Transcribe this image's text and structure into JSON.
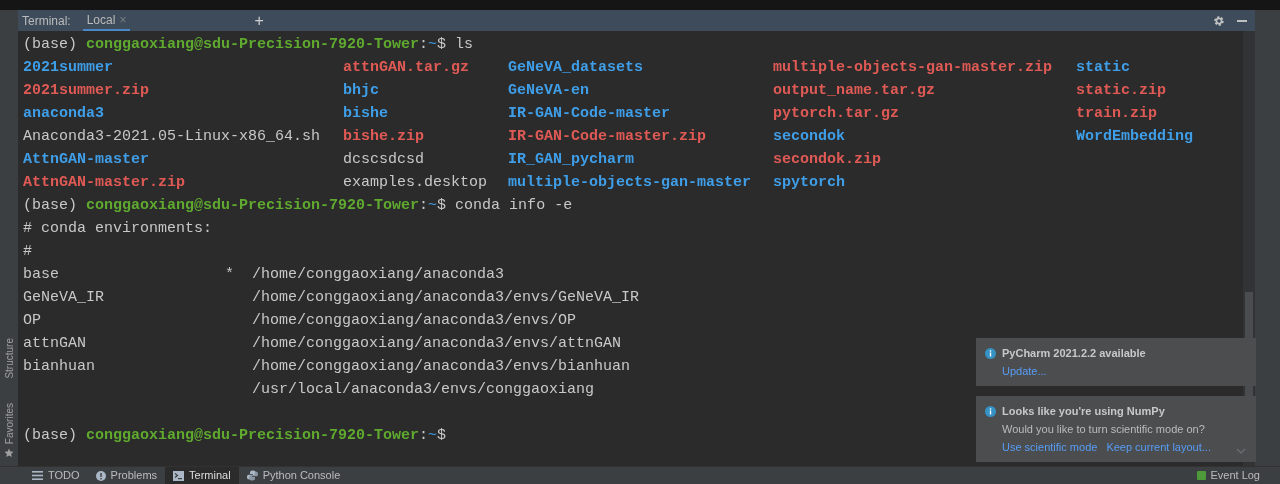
{
  "tool_window": {
    "title": "Terminal:",
    "tabs": [
      {
        "label": "Local",
        "close": "×",
        "selected": true
      }
    ],
    "add": "+"
  },
  "side_labels": [
    "Structure",
    "Favorites"
  ],
  "terminal": {
    "ls_prompt": {
      "env": "(base)",
      "user_host": "conggaoxiang@sdu-Precision-7920-Tower",
      "path": ":~$",
      "command": "ls"
    },
    "ls_columns": [
      [
        {
          "text": "2021summer",
          "kind": "dir"
        },
        {
          "text": "2021summer.zip",
          "kind": "archive"
        },
        {
          "text": "anaconda3",
          "kind": "dir"
        },
        {
          "text": "Anaconda3-2021.05-Linux-x86_64.sh",
          "kind": "file"
        },
        {
          "text": "AttnGAN-master",
          "kind": "dir"
        },
        {
          "text": "AttnGAN-master.zip",
          "kind": "archive"
        }
      ],
      [
        {
          "text": "attnGAN.tar.gz",
          "kind": "archive"
        },
        {
          "text": "bhjc",
          "kind": "dir"
        },
        {
          "text": "bishe",
          "kind": "dir"
        },
        {
          "text": "bishe.zip",
          "kind": "archive"
        },
        {
          "text": "dcscsdcsd",
          "kind": "file"
        },
        {
          "text": "examples.desktop",
          "kind": "file"
        }
      ],
      [
        {
          "text": "GeNeVA_datasets",
          "kind": "dir"
        },
        {
          "text": "GeNeVA-en",
          "kind": "dir"
        },
        {
          "text": "IR-GAN-Code-master",
          "kind": "dir"
        },
        {
          "text": "IR-GAN-Code-master.zip",
          "kind": "archive"
        },
        {
          "text": "IR_GAN_pycharm",
          "kind": "dir"
        },
        {
          "text": "multiple-objects-gan-master",
          "kind": "dir"
        }
      ],
      [
        {
          "text": "multiple-objects-gan-master.zip",
          "kind": "archive"
        },
        {
          "text": "output_name.tar.gz",
          "kind": "archive"
        },
        {
          "text": "pytorch.tar.gz",
          "kind": "archive"
        },
        {
          "text": "secondok",
          "kind": "dir"
        },
        {
          "text": "secondok.zip",
          "kind": "archive"
        },
        {
          "text": "spytorch",
          "kind": "dir"
        }
      ],
      [
        {
          "text": "static",
          "kind": "dir"
        },
        {
          "text": "static.zip",
          "kind": "archive"
        },
        {
          "text": "train.zip",
          "kind": "archive"
        },
        {
          "text": "WordEmbedding",
          "kind": "dir"
        }
      ]
    ],
    "conda_prompt": {
      "env": "(base)",
      "user_host": "conggaoxiang@sdu-Precision-7920-Tower",
      "path": ":~$",
      "command": "conda info -e"
    },
    "output_lines": [
      "# conda environments:",
      "#"
    ],
    "environments": [
      {
        "name": "base",
        "active": "*",
        "path": "/home/conggaoxiang/anaconda3"
      },
      {
        "name": "GeNeVA_IR",
        "path": "/home/conggaoxiang/anaconda3/envs/GeNeVA_IR"
      },
      {
        "name": "OP",
        "path": "/home/conggaoxiang/anaconda3/envs/OP"
      },
      {
        "name": "attnGAN",
        "path": "/home/conggaoxiang/anaconda3/envs/attnGAN"
      },
      {
        "name": "bianhuan",
        "path": "/home/conggaoxiang/anaconda3/envs/bianhuan"
      },
      {
        "path": "/usr/local/anaconda3/envs/conggaoxiang"
      }
    ],
    "last_prompt": {
      "env": "(base)",
      "user_host": "conggaoxiang@sdu-Precision-7920-Tower",
      "path": ":~$"
    }
  },
  "notifications": [
    {
      "title": "PyCharm 2021.2.2 available",
      "links": [
        "Update..."
      ]
    },
    {
      "title": "Looks like you're using NumPy",
      "body": "Would you like to turn scientific mode on?",
      "links": [
        "Use scientific mode",
        "Keep current layout..."
      ]
    }
  ],
  "bottom_tabs": [
    {
      "label": "TODO",
      "kind": "list",
      "selected": false
    },
    {
      "label": "Problems",
      "kind": "alert",
      "selected": false
    },
    {
      "label": "Terminal",
      "kind": "terminal",
      "selected": true
    },
    {
      "label": "Python Console",
      "kind": "python",
      "selected": false
    }
  ],
  "event_log": "Event Log"
}
